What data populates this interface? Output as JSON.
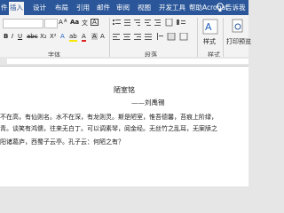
{
  "tabs": [
    "件",
    "插入",
    "设计",
    "布局",
    "引用",
    "邮件",
    "审阅",
    "视图",
    "开发工具",
    "帮助",
    "Acrobat",
    "告诉我"
  ],
  "ribbon": {
    "style_label": "样式",
    "find_label": "打印预览",
    "groups": [
      "字体",
      "段落",
      "样式"
    ]
  },
  "document": {
    "title": "陋室铭",
    "author": "——刘禹锡",
    "lines": [
      "不在高，有仙则名。水不在深，有龙则灵。斯是陋室，惟吾德馨，苔痕上阶绿，",
      "青。谈笑有鸿儒，往来无白丁。可以调素琴，阅金经。无丝竹之乱耳，无案牍之",
      "阳诸葛庐，西蜀子云亭。孔子云：何陋之有？"
    ]
  },
  "colors": {
    "brand": "#2b579a",
    "ribbon_bg": "#f3f3f3",
    "page_bg": "#ffffff"
  }
}
